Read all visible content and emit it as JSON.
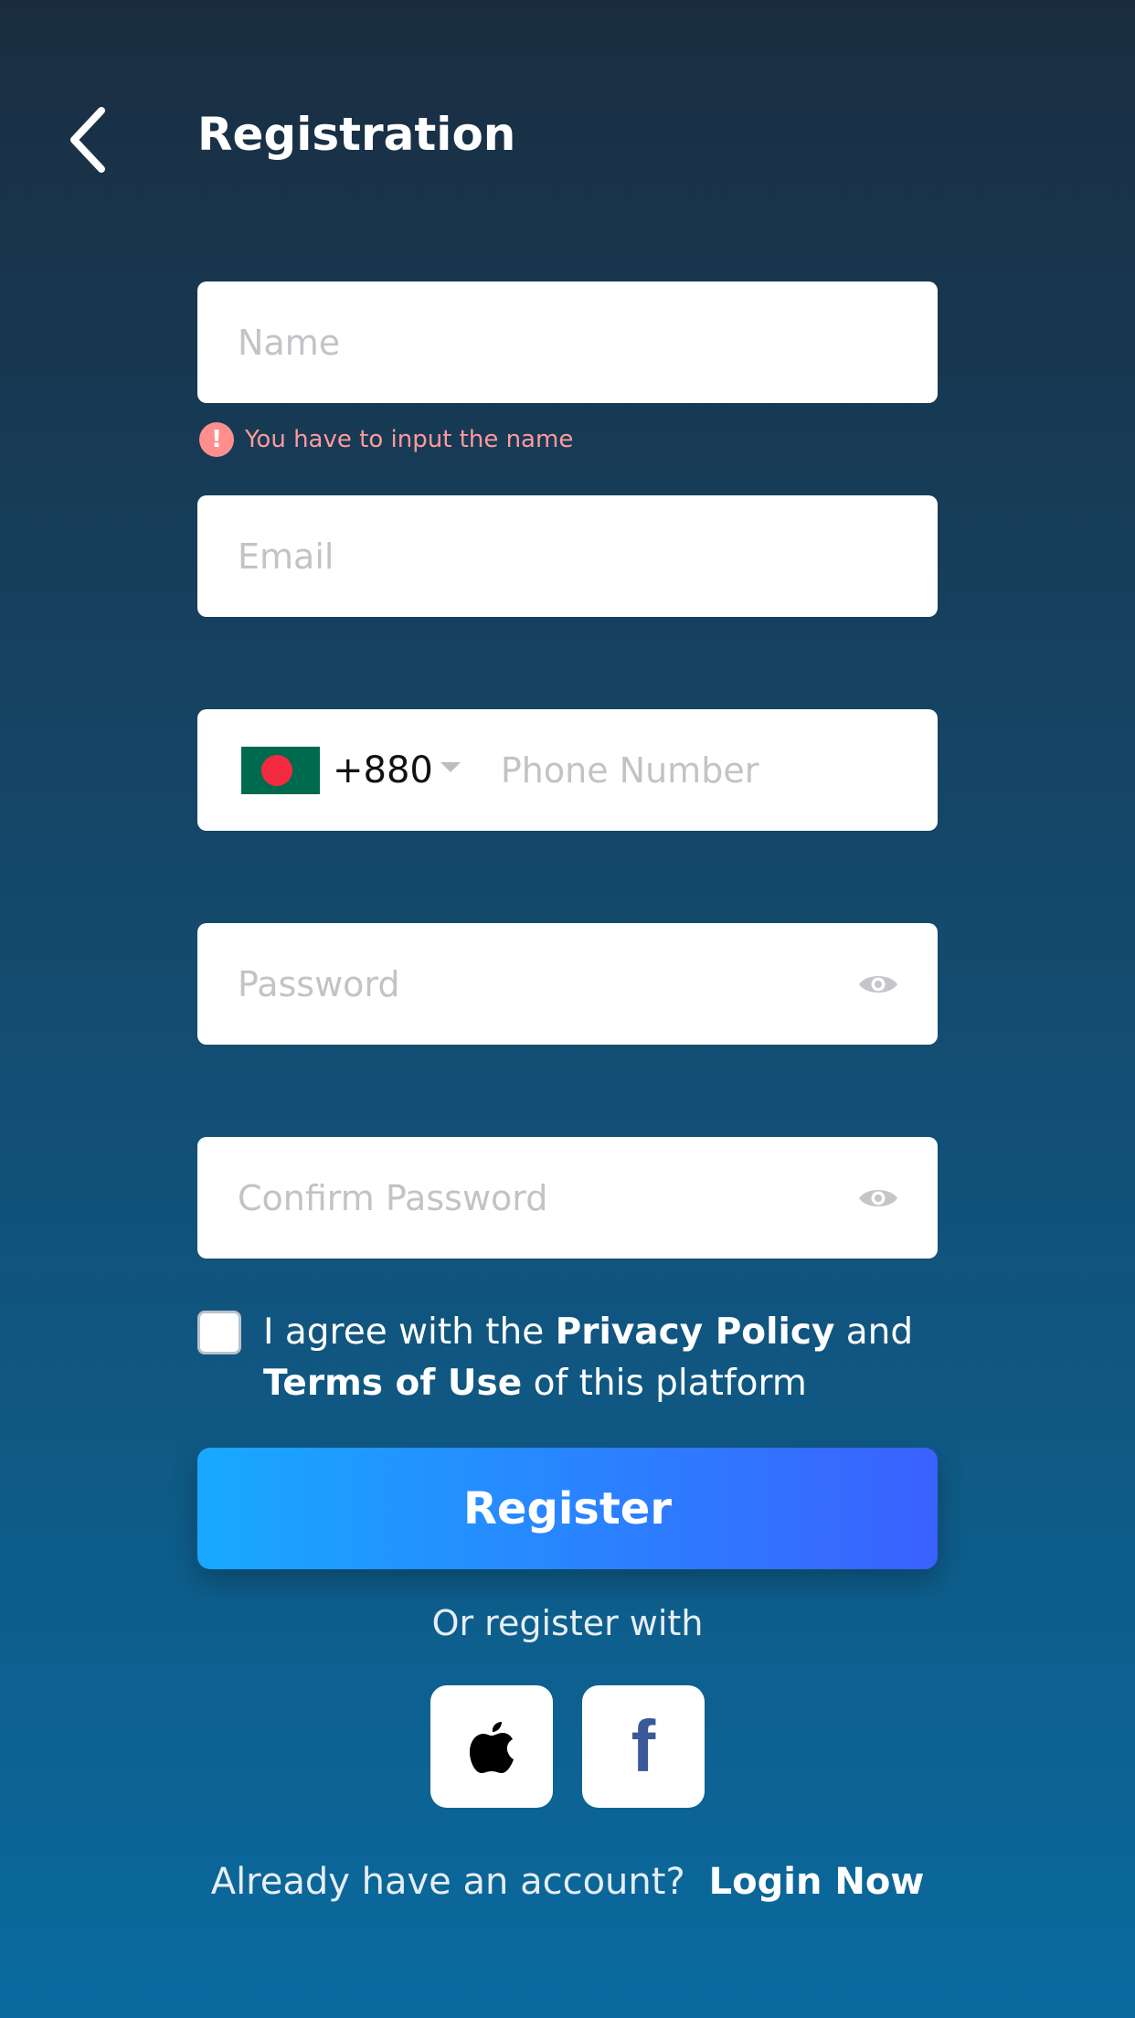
{
  "header": {
    "title": "Registration",
    "back_icon": "chevron-left-icon"
  },
  "form": {
    "name": {
      "placeholder": "Name",
      "value": "",
      "error": "You have to input the name",
      "error_icon": "!"
    },
    "email": {
      "placeholder": "Email",
      "value": ""
    },
    "phone": {
      "country_flag": "Bangladesh",
      "country_code": "+880",
      "placeholder": "Phone Number",
      "value": ""
    },
    "password": {
      "placeholder": "Password",
      "value": ""
    },
    "confirm_password": {
      "placeholder": "Confirm Password",
      "value": ""
    },
    "agreement": {
      "checked": false,
      "prefix": "I agree with the",
      "privacy_link": "Privacy Policy",
      "middle": "and",
      "terms_link": "Terms of Use",
      "suffix": "of this platform"
    },
    "register_label": "Register"
  },
  "social": {
    "label": "Or register with",
    "providers": [
      "apple",
      "facebook"
    ],
    "facebook_glyph": "f"
  },
  "footer": {
    "prompt": "Already have an account?",
    "login_label": "Login Now"
  },
  "colors": {
    "background_top": "#1a2d40",
    "background_bottom": "#0a6a9f",
    "button_start": "#18a9ff",
    "button_end": "#3a61ff",
    "error": "#ff8f8f",
    "facebook": "#3b5998"
  }
}
